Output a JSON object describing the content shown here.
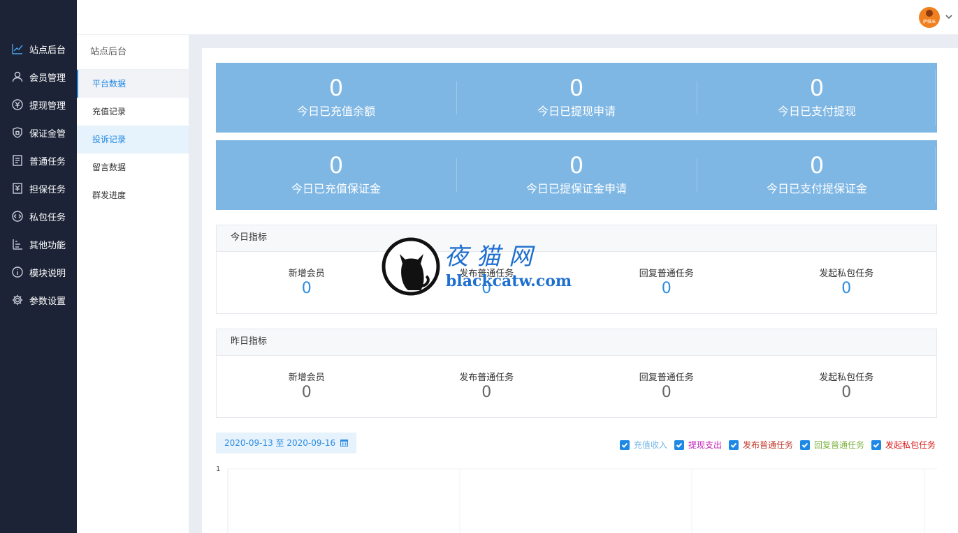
{
  "sidebar": {
    "items": [
      {
        "label": "站点后台",
        "icon": "line-chart-icon"
      },
      {
        "label": "会员管理",
        "icon": "user-icon"
      },
      {
        "label": "提现管理",
        "icon": "yen-icon"
      },
      {
        "label": "保证金管",
        "icon": "shield-icon"
      },
      {
        "label": "普通任务",
        "icon": "receipt-icon"
      },
      {
        "label": "担保任务",
        "icon": "voucher-icon"
      },
      {
        "label": "私包任务",
        "icon": "code-icon"
      },
      {
        "label": "其他功能",
        "icon": "list-icon"
      },
      {
        "label": "模块说明",
        "icon": "info-icon"
      },
      {
        "label": "参数设置",
        "icon": "gear-icon"
      }
    ]
  },
  "header": {
    "avatar_text": "萨维米"
  },
  "subnav": {
    "title": "站点后台",
    "items": [
      "平台数据",
      "充值记录",
      "投诉记录",
      "留言数据",
      "群发进度"
    ]
  },
  "stats_row1": [
    {
      "value": "0",
      "label": "今日已充值余额"
    },
    {
      "value": "0",
      "label": "今日已提现申请"
    },
    {
      "value": "0",
      "label": "今日已支付提现"
    }
  ],
  "stats_row2": [
    {
      "value": "0",
      "label": "今日已充值保证金"
    },
    {
      "value": "0",
      "label": "今日已提保证金申请"
    },
    {
      "value": "0",
      "label": "今日已支付提保证金"
    }
  ],
  "today": {
    "title": "今日指标",
    "metrics": [
      {
        "label": "新增会员",
        "value": "0"
      },
      {
        "label": "发布普通任务",
        "value": "0"
      },
      {
        "label": "回复普通任务",
        "value": "0"
      },
      {
        "label": "发起私包任务",
        "value": "0"
      }
    ]
  },
  "yesterday": {
    "title": "昨日指标",
    "metrics": [
      {
        "label": "新增会员",
        "value": "0"
      },
      {
        "label": "发布普通任务",
        "value": "0"
      },
      {
        "label": "回复普通任务",
        "value": "0"
      },
      {
        "label": "发起私包任务",
        "value": "0"
      }
    ]
  },
  "date_range": "2020-09-13 至 2020-09-16",
  "legend": [
    {
      "label": "充值收入",
      "color": "#6fb3e6"
    },
    {
      "label": "提现支出",
      "color": "#c21fb9"
    },
    {
      "label": "发布普通任务",
      "color": "#c0392b"
    },
    {
      "label": "回复普通任务",
      "color": "#7cb342"
    },
    {
      "label": "发起私包任务",
      "color": "#d81b1b"
    }
  ],
  "chart_y_tick": "1",
  "watermark": {
    "title": "夜猫网",
    "url": "blackcatw.com"
  }
}
